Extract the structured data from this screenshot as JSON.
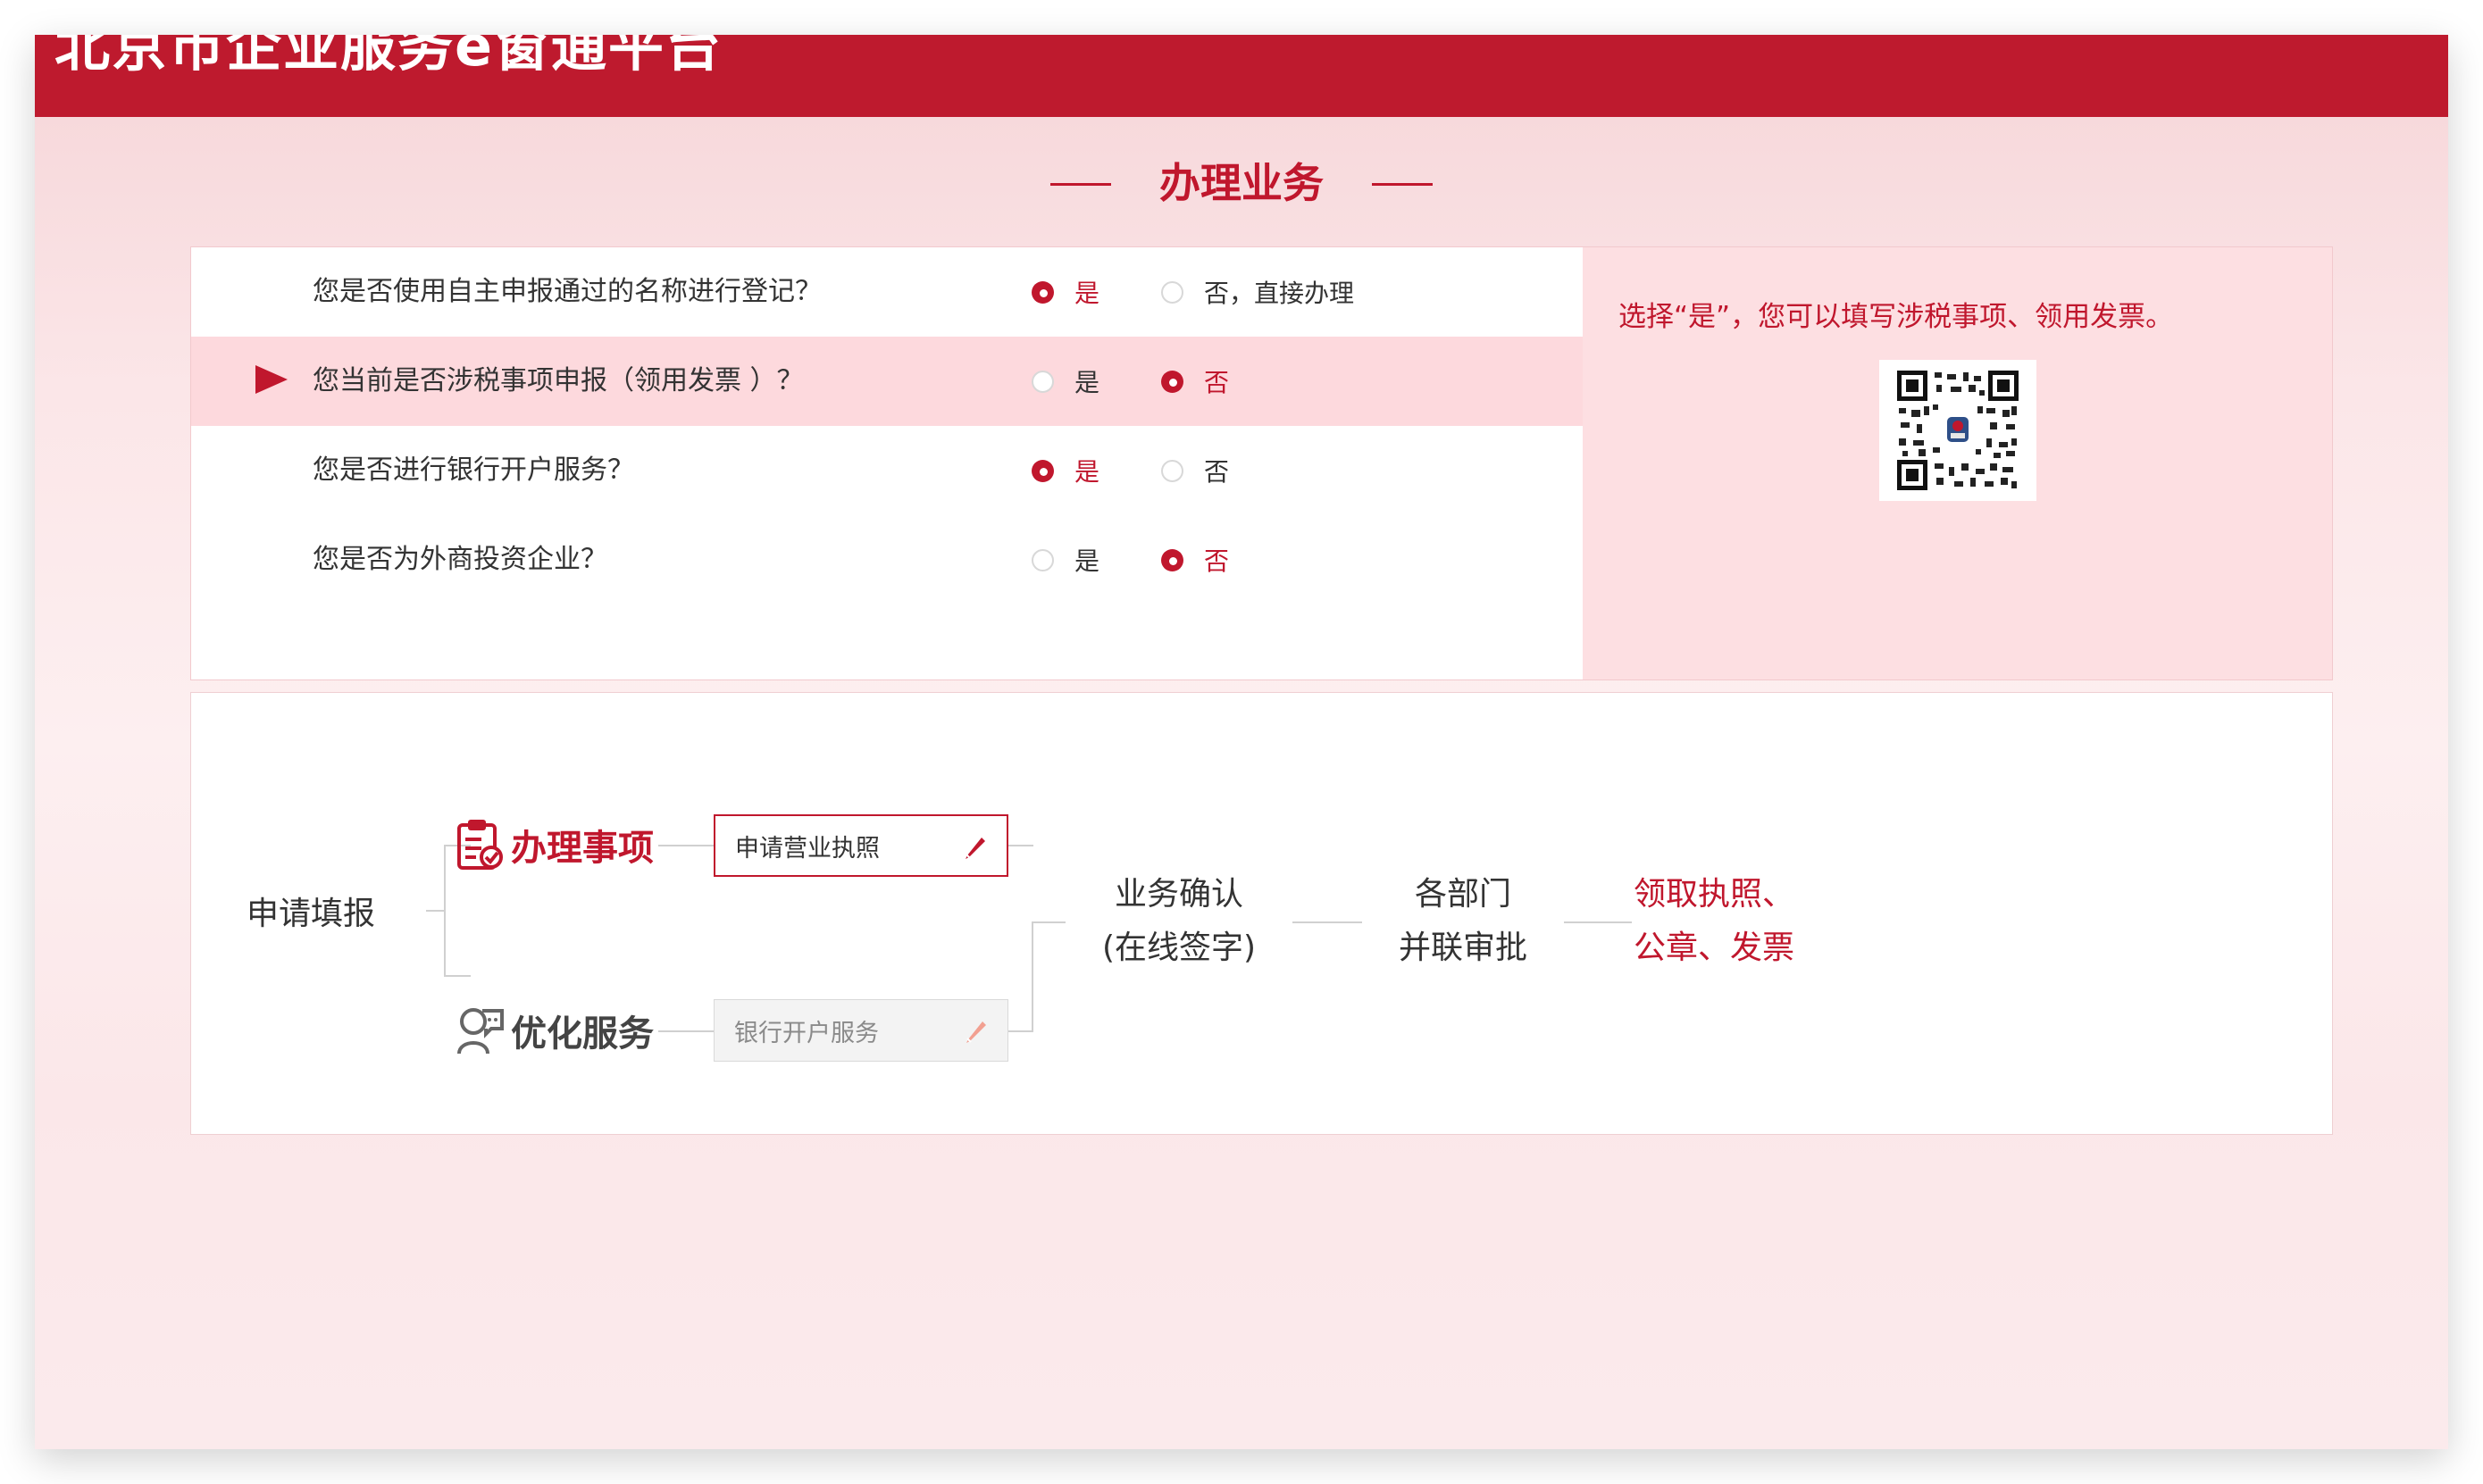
{
  "header": {
    "title": "北京市企业服务e窗通平台"
  },
  "section": {
    "title": "办理业务"
  },
  "questions": [
    {
      "text": "您是否使用自主申报通过的名称进行登记？",
      "yes_label": "是",
      "no_label": "否，直接办理",
      "selected": "yes",
      "active": false
    },
    {
      "text": "您当前是否涉税事项申报（领用发票 ）？",
      "yes_label": "是",
      "no_label": "否",
      "selected": "no",
      "active": true
    },
    {
      "text": "您是否进行银行开户服务？",
      "yes_label": "是",
      "no_label": "否",
      "selected": "yes",
      "active": false
    },
    {
      "text": "您是否为外商投资企业？",
      "yes_label": "是",
      "no_label": "否",
      "selected": "no",
      "active": false
    }
  ],
  "tip": {
    "text": "选择“是”，您可以填写涉税事项、领用发票。"
  },
  "process": {
    "root_label": "申请填报",
    "handle": {
      "label": "办理事项",
      "input": "申请营业执照"
    },
    "optimize": {
      "label": "优化服务",
      "input": "银行开户服务"
    },
    "steps": [
      {
        "line1": "业务确认",
        "line2": "(在线签字)"
      },
      {
        "line1": "各部门",
        "line2": "并联审批"
      },
      {
        "line1": "领取执照、",
        "line2": "公章、发票"
      }
    ]
  },
  "colors": {
    "brand": "#be1a2e",
    "accent": "#c0172d",
    "highlight_row": "#fdd9dd",
    "tip_panel": "#fddfe2"
  },
  "icons": {
    "arrow": "arrow-right-icon",
    "radio": "radio-icon",
    "qr": "qr-code-icon",
    "clipboard": "clipboard-check-icon",
    "service": "people-service-icon",
    "pencil": "pencil-icon"
  }
}
